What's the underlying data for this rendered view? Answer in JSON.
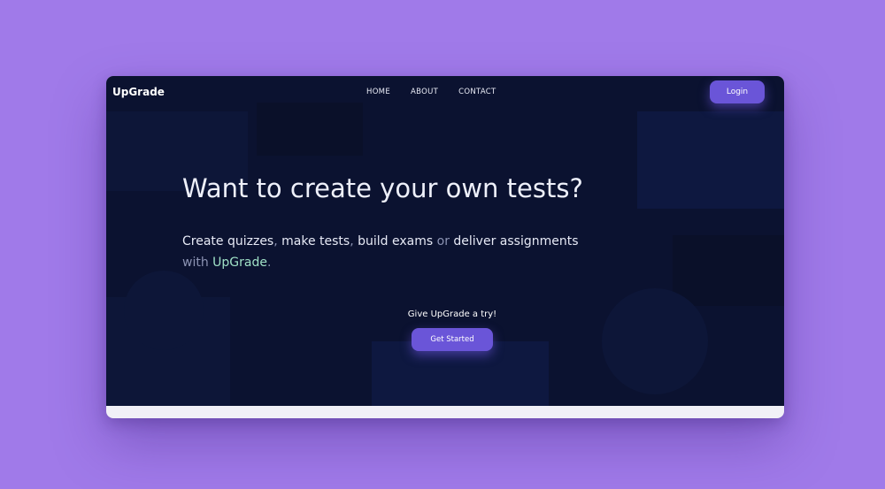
{
  "brand": "UpGrade",
  "nav": {
    "items": [
      "HOME",
      "ABOUT",
      "CONTACT"
    ],
    "login_label": "Login"
  },
  "hero": {
    "headline": "Want to create your own tests?",
    "sub_line1": {
      "part1": "Create quizzes",
      "sep1": ",",
      "part2": "make tests",
      "sep2": ",",
      "part3": "build exams",
      "conj": "or",
      "part4": "deliver assignments"
    },
    "sub_line2": {
      "prefix": "with",
      "brand": "UpGrade",
      "suffix": "."
    },
    "cta_text": "Give UpGrade a try!",
    "cta_button": "Get Started"
  },
  "colors": {
    "page_background": "#a07ae9",
    "hero_background": "#0b1230",
    "button": "#6a55d8",
    "accent_text": "#9fe0c6",
    "footer_strip": "#f1f0f7"
  }
}
